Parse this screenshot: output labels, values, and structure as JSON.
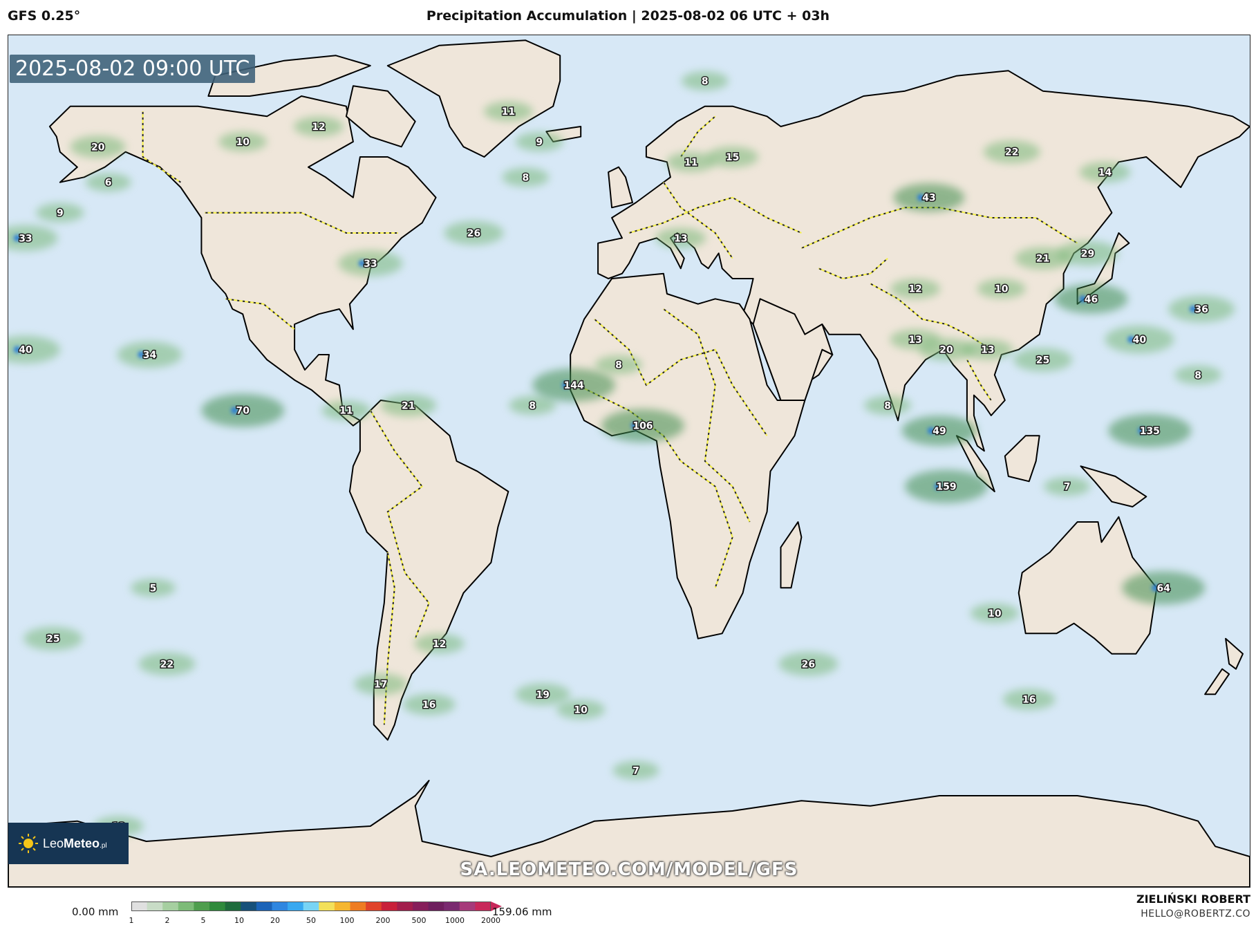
{
  "header": {
    "model_label": "GFS 0.25°",
    "title": "Precipitation Accumulation | 2025-08-02 06 UTC + 03h"
  },
  "map": {
    "valid_time": "2025-08-02 09:00 UTC",
    "brand": {
      "name_light": "Leo",
      "name_bold": "Meteo",
      "suffix": ".pl"
    },
    "site_url": "SA.LEOMETEO.COM/MODEL/GFS",
    "colors": {
      "ocean": "#d7e8f6",
      "land": "#efe6da",
      "border": "#f5f04a",
      "coast": "#000000"
    },
    "precip_labels": [
      {
        "v": "11",
        "lon": -35,
        "lat": 69
      },
      {
        "v": "8",
        "lon": 22,
        "lat": 75
      },
      {
        "v": "12",
        "lon": -90,
        "lat": 66
      },
      {
        "v": "10",
        "lon": -112,
        "lat": 63
      },
      {
        "v": "20",
        "lon": -154,
        "lat": 62
      },
      {
        "v": "9",
        "lon": -26,
        "lat": 63
      },
      {
        "v": "6",
        "lon": -151,
        "lat": 55
      },
      {
        "v": "8",
        "lon": -30,
        "lat": 56
      },
      {
        "v": "9",
        "lon": -165,
        "lat": 49
      },
      {
        "v": "33",
        "lon": -175,
        "lat": 44
      },
      {
        "v": "26",
        "lon": -45,
        "lat": 45
      },
      {
        "v": "33",
        "lon": -75,
        "lat": 39
      },
      {
        "v": "40",
        "lon": -175,
        "lat": 22
      },
      {
        "v": "34",
        "lon": -139,
        "lat": 21
      },
      {
        "v": "70",
        "lon": -112,
        "lat": 10
      },
      {
        "v": "11",
        "lon": -82,
        "lat": 10
      },
      {
        "v": "21",
        "lon": -64,
        "lat": 11
      },
      {
        "v": "8",
        "lon": -28,
        "lat": 11
      },
      {
        "v": "144",
        "lon": -16,
        "lat": 15
      },
      {
        "v": "8",
        "lon": -3,
        "lat": 19
      },
      {
        "v": "106",
        "lon": 4,
        "lat": 7
      },
      {
        "v": "15",
        "lon": 30,
        "lat": 60
      },
      {
        "v": "11",
        "lon": 18,
        "lat": 59
      },
      {
        "v": "13",
        "lon": 15,
        "lat": 44
      },
      {
        "v": "43",
        "lon": 87,
        "lat": 52
      },
      {
        "v": "22",
        "lon": 111,
        "lat": 61
      },
      {
        "v": "14",
        "lon": 138,
        "lat": 57
      },
      {
        "v": "21",
        "lon": 120,
        "lat": 40
      },
      {
        "v": "29",
        "lon": 133,
        "lat": 41
      },
      {
        "v": "10",
        "lon": 108,
        "lat": 34
      },
      {
        "v": "12",
        "lon": 83,
        "lat": 34
      },
      {
        "v": "46",
        "lon": 134,
        "lat": 32
      },
      {
        "v": "36",
        "lon": 166,
        "lat": 30
      },
      {
        "v": "40",
        "lon": 148,
        "lat": 24
      },
      {
        "v": "13",
        "lon": 83,
        "lat": 24
      },
      {
        "v": "20",
        "lon": 92,
        "lat": 22
      },
      {
        "v": "13",
        "lon": 104,
        "lat": 22
      },
      {
        "v": "25",
        "lon": 120,
        "lat": 20
      },
      {
        "v": "8",
        "lon": 165,
        "lat": 17
      },
      {
        "v": "8",
        "lon": 75,
        "lat": 11
      },
      {
        "v": "49",
        "lon": 90,
        "lat": 6
      },
      {
        "v": "135",
        "lon": 151,
        "lat": 6
      },
      {
        "v": "159",
        "lon": 92,
        "lat": -5
      },
      {
        "v": "7",
        "lon": 127,
        "lat": -5
      },
      {
        "v": "64",
        "lon": 155,
        "lat": -25
      },
      {
        "v": "10",
        "lon": 106,
        "lat": -30
      },
      {
        "v": "5",
        "lon": -138,
        "lat": -25
      },
      {
        "v": "25",
        "lon": -167,
        "lat": -35
      },
      {
        "v": "22",
        "lon": -134,
        "lat": -40
      },
      {
        "v": "17",
        "lon": -72,
        "lat": -44
      },
      {
        "v": "12",
        "lon": -55,
        "lat": -36
      },
      {
        "v": "16",
        "lon": -58,
        "lat": -48
      },
      {
        "v": "19",
        "lon": -25,
        "lat": -46
      },
      {
        "v": "10",
        "lon": -14,
        "lat": -49
      },
      {
        "v": "26",
        "lon": 52,
        "lat": -40
      },
      {
        "v": "16",
        "lon": 116,
        "lat": -47
      },
      {
        "v": "7",
        "lon": 2,
        "lat": -61
      },
      {
        "v": "12",
        "lon": -148,
        "lat": -72
      }
    ]
  },
  "legend": {
    "min_label": "0.00 mm",
    "max_label": "159.06 mm",
    "ticks": [
      "1",
      "2",
      "5",
      "10",
      "20",
      "50",
      "100",
      "200",
      "500",
      "1000",
      "2000"
    ],
    "colors": [
      "#e0e0e0",
      "#c8dcc6",
      "#a6cfa0",
      "#7dbb78",
      "#4f9e4e",
      "#2f8a3c",
      "#1e6b3c",
      "#16507a",
      "#1b63b8",
      "#2f86e0",
      "#38a8f0",
      "#78d4f5",
      "#f3e05a",
      "#f5b630",
      "#ee7c22",
      "#e0432a",
      "#c8203a",
      "#a21e4c",
      "#861e5a",
      "#6e1f5e",
      "#7a2a70",
      "#a63a7a",
      "#c8285a"
    ]
  },
  "author": {
    "name": "ZIELIŃSKI ROBERT",
    "email": "HELLO@ROBERTZ.CO"
  }
}
